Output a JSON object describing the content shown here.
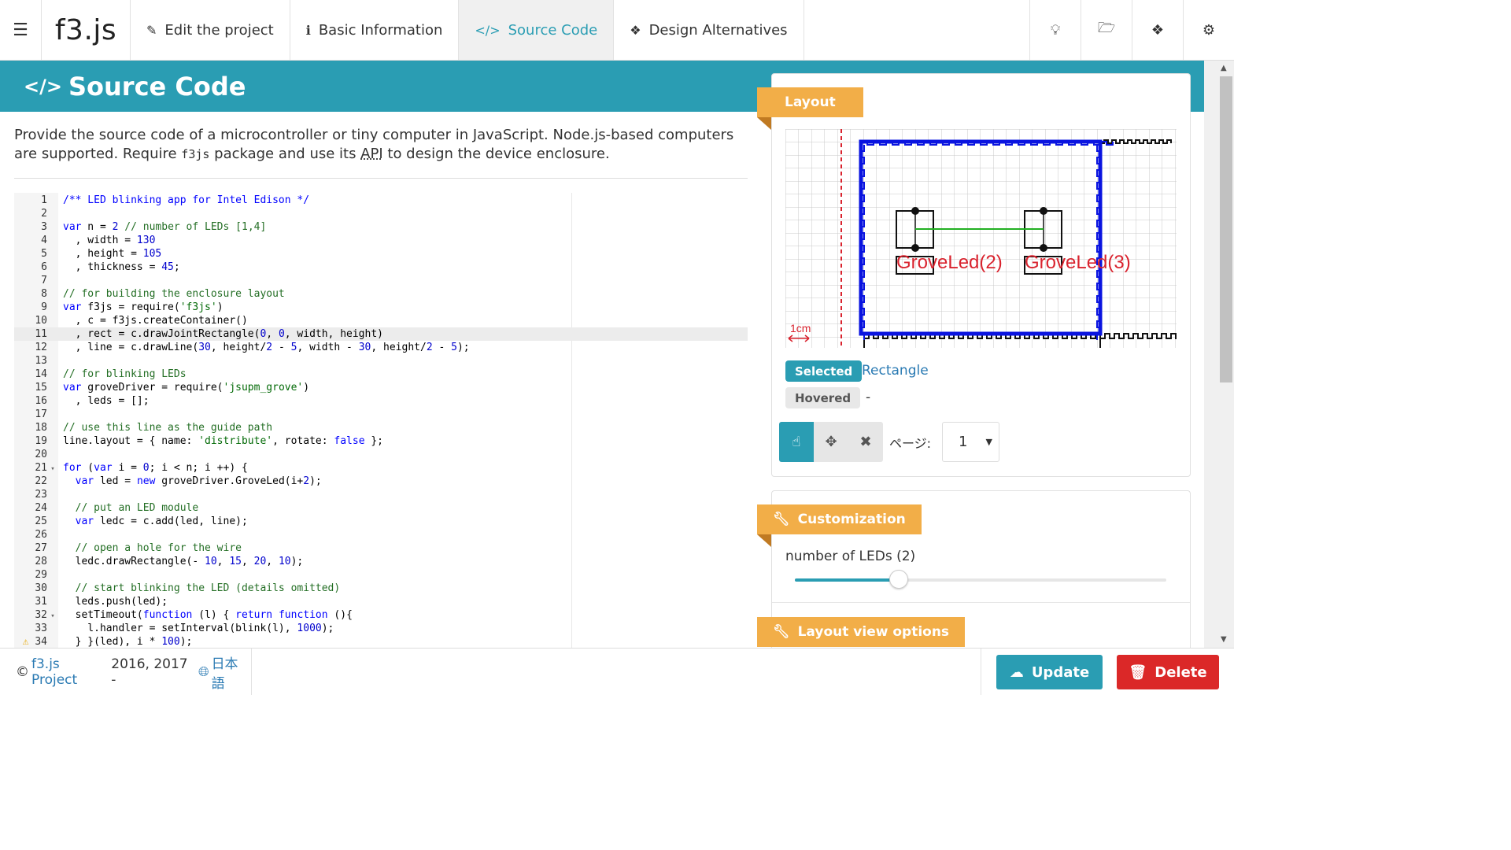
{
  "nav": {
    "brand": "f3.js",
    "tabs": [
      {
        "label": "Edit the project",
        "icon": "pencil-icon",
        "glyph": "✎"
      },
      {
        "label": "Basic Information",
        "icon": "info-circle-icon",
        "glyph": "ℹ"
      },
      {
        "label": "Source Code",
        "icon": "code-icon",
        "glyph": "</>"
      },
      {
        "label": "Design Alternatives",
        "icon": "cubes-icon",
        "glyph": "❖"
      }
    ],
    "right_icons": [
      "lightbulb-icon",
      "folder-open-icon",
      "cubes-icon",
      "settings-icon"
    ]
  },
  "header": {
    "title": "Source Code",
    "icon": "code-icon"
  },
  "description": {
    "part1": "Provide the source code of a microcontroller or tiny computer in JavaScript. Node.js-based computers are supported. Require ",
    "code": "f3js",
    "part2": " package and use its ",
    "abbr": "API",
    "part3": " to design the device enclosure."
  },
  "editor": {
    "active_line": 11,
    "lines": [
      {
        "n": "1",
        "html": "<span class=\"kw\">/** LED blinking app for Intel Edison */</span>"
      },
      {
        "n": "2",
        "html": ""
      },
      {
        "n": "3",
        "html": "<span class=\"kw\">var</span> n = <span class=\"nm\">2</span> <span class=\"cm\">// number of LEDs [1,4]</span>"
      },
      {
        "n": "4",
        "html": "  , width = <span class=\"nm\">130</span>"
      },
      {
        "n": "5",
        "html": "  , height = <span class=\"nm\">105</span>"
      },
      {
        "n": "6",
        "html": "  , thickness = <span class=\"nm\">45</span>;"
      },
      {
        "n": "7",
        "html": ""
      },
      {
        "n": "8",
        "html": "<span class=\"cm\">// for building the enclosure layout</span>"
      },
      {
        "n": "9",
        "html": "<span class=\"kw\">var</span> f3js = require(<span class=\"str\">'f3js'</span>)"
      },
      {
        "n": "10",
        "html": "  , c = f3js.createContainer()"
      },
      {
        "n": "11",
        "html": "  , rect = c.drawJointRectangle(<span class=\"nm\">0</span>, <span class=\"nm\">0</span>, width, height)"
      },
      {
        "n": "12",
        "html": "  , line = c.drawLine(<span class=\"nm\">30</span>, height/<span class=\"nm\">2</span> - <span class=\"nm\">5</span>, width - <span class=\"nm\">30</span>, height/<span class=\"nm\">2</span> - <span class=\"nm\">5</span>);"
      },
      {
        "n": "13",
        "html": ""
      },
      {
        "n": "14",
        "html": "<span class=\"cm\">// for blinking LEDs</span>"
      },
      {
        "n": "15",
        "html": "<span class=\"kw\">var</span> groveDriver = require(<span class=\"str\">'jsupm_grove'</span>)"
      },
      {
        "n": "16",
        "html": "  , leds = [];"
      },
      {
        "n": "17",
        "html": ""
      },
      {
        "n": "18",
        "html": "<span class=\"cm\">// use this line as the guide path</span>"
      },
      {
        "n": "19",
        "html": "line.layout = { name: <span class=\"str\">'distribute'</span>, rotate: <span class=\"kw\">false</span> };"
      },
      {
        "n": "20",
        "html": ""
      },
      {
        "n": "21",
        "fold": "▾",
        "html": "<span class=\"kw\">for</span> (<span class=\"kw\">var</span> i = <span class=\"nm\">0</span>; i &lt; n; i ++) {"
      },
      {
        "n": "22",
        "html": "  <span class=\"kw\">var</span> led = <span class=\"kw\">new</span> groveDriver.GroveLed(i+<span class=\"nm\">2</span>);"
      },
      {
        "n": "23",
        "html": ""
      },
      {
        "n": "24",
        "html": "  <span class=\"cm\">// put an LED module</span>"
      },
      {
        "n": "25",
        "html": "  <span class=\"kw\">var</span> ledc = c.add(led, line);"
      },
      {
        "n": "26",
        "html": ""
      },
      {
        "n": "27",
        "html": "  <span class=\"cm\">// open a hole for the wire</span>"
      },
      {
        "n": "28",
        "html": "  ledc.drawRectangle(- <span class=\"nm\">10</span>, <span class=\"nm\">15</span>, <span class=\"nm\">20</span>, <span class=\"nm\">10</span>);"
      },
      {
        "n": "29",
        "html": ""
      },
      {
        "n": "30",
        "html": "  <span class=\"cm\">// start blinking the LED (details omitted)</span>"
      },
      {
        "n": "31",
        "html": "  leds.push(led);"
      },
      {
        "n": "32",
        "fold": "▾",
        "html": "  setTimeout(<span class=\"kw\">function</span> (l) { <span class=\"kw\">return</span> <span class=\"kw\">function</span> (){"
      },
      {
        "n": "33",
        "html": "    l.handler = setInterval(blink(l), <span class=\"nm\">1000</span>);"
      },
      {
        "n": "34",
        "warn": "⚠",
        "html": "  } }(led), i * <span class=\"nm\">100</span>);"
      }
    ]
  },
  "layout_panel": {
    "ribbon": "Layout",
    "scale_label": "1cm",
    "led_labels": [
      "GroveLed(2)",
      "GroveLed(3)"
    ],
    "selected_tag": "Selected",
    "selected_value": "Rectangle",
    "hovered_tag": "Hovered",
    "hovered_value": "-",
    "tools": [
      {
        "name": "pointer-tool-icon",
        "glyph": "☝"
      },
      {
        "name": "move-tool-icon",
        "glyph": "✥"
      },
      {
        "name": "delete-tool-icon",
        "glyph": "✖"
      }
    ],
    "page_label": "ページ:",
    "page_value": "1"
  },
  "customization": {
    "ribbon": "Customization",
    "slider_label": "number of LEDs (2)",
    "slider_fraction": 0.28
  },
  "layout_view_options": {
    "ribbon": "Layout view options"
  },
  "footer": {
    "copyright": "©",
    "project_link": "f3.js Project",
    "years": "2016, 2017 -",
    "language": "日本語",
    "update_label": "Update",
    "delete_label": "Delete"
  },
  "colors": {
    "accent": "#2a9db3",
    "ribbon": "#f2ae48",
    "danger": "#db2828"
  }
}
